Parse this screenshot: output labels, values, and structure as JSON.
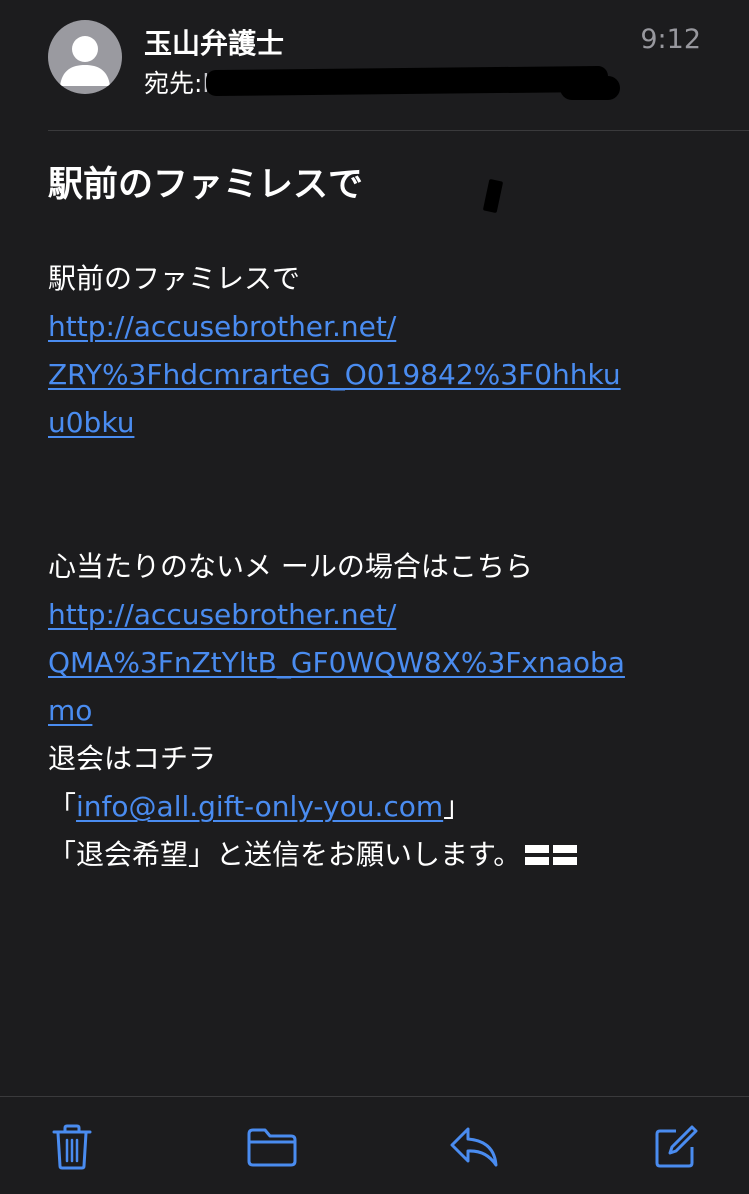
{
  "header": {
    "sender": "玉山弁護士",
    "recipient_label": "宛先:",
    "recipient_prefix": "k",
    "time": "9:12"
  },
  "subject": "駅前のファミレスで",
  "body": {
    "line1": "駅前のファミレスで",
    "link1": [
      "http://accusebrother.net/",
      "ZRY%3FhdcmrarteG_O019842%3F0hhku",
      "u0bku"
    ],
    "line2": "心当たりのないメ ールの場合はこちら",
    "link2": [
      "http://accusebrother.net/",
      "QMA%3FnZtYltB_GF0WQW8X%3Fxnaoba",
      "mo"
    ],
    "line3": "退会はコチラ",
    "email_open": "「",
    "email": "info@all.gift-only-you.com",
    "email_close": "」",
    "line4": "「退会希望」と送信をお願いします。"
  },
  "toolbar": {
    "icons": [
      "trash-icon",
      "folder-icon",
      "reply-icon",
      "compose-icon"
    ],
    "accent": "#4a8cf0"
  },
  "colors": {
    "background": "#1c1c1e",
    "link": "#4a8cf0",
    "secondary_text": "#98989e"
  }
}
